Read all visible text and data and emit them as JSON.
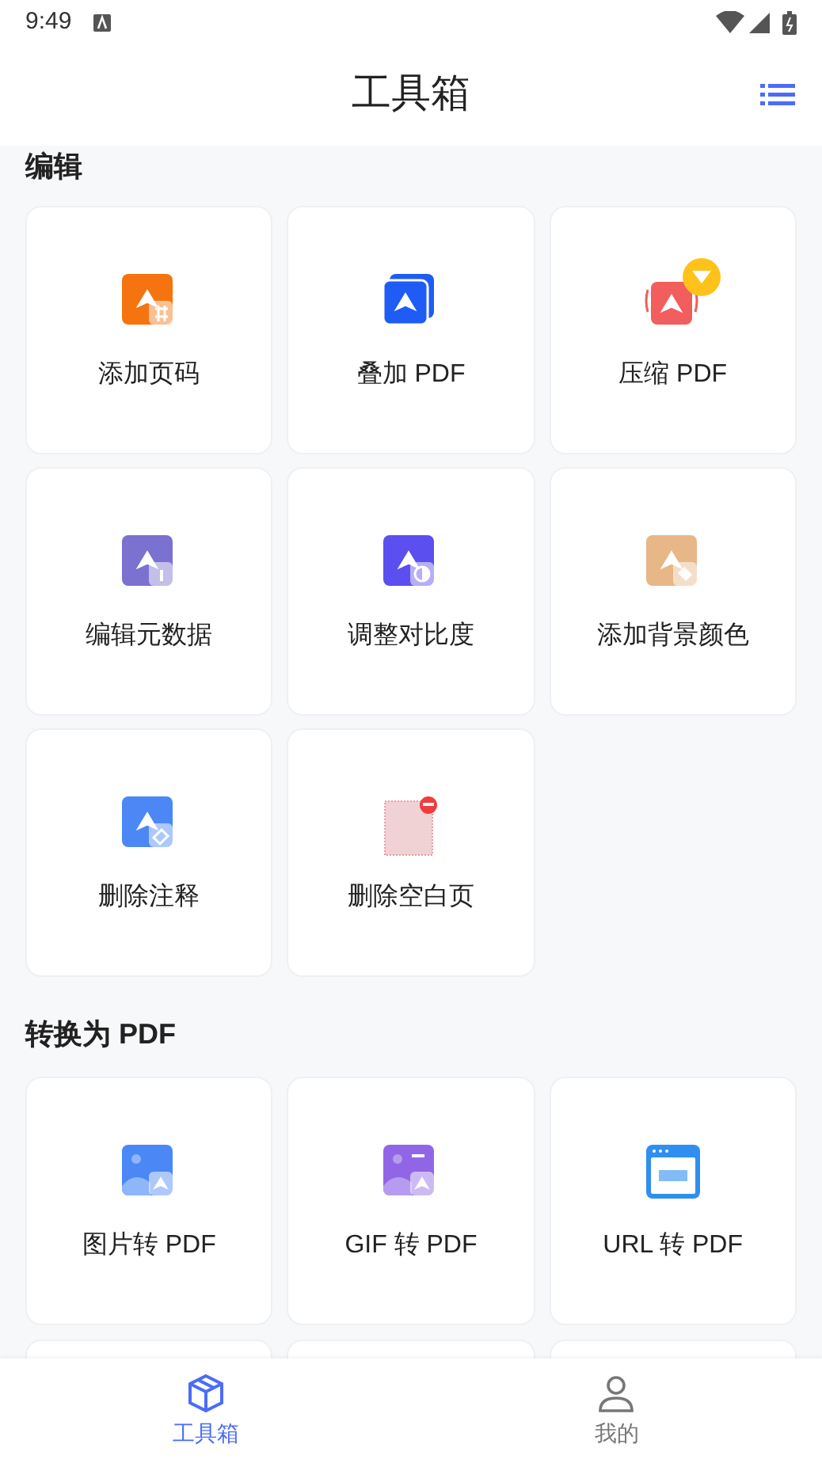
{
  "status_bar": {
    "time": "9:49"
  },
  "header": {
    "title": "工具箱"
  },
  "sections": [
    {
      "title": "编辑",
      "tools": [
        {
          "label": "添加页码",
          "kind": "page-number",
          "vip": false
        },
        {
          "label": "叠加 PDF",
          "kind": "overlay",
          "vip": false
        },
        {
          "label": "压缩 PDF",
          "kind": "compress",
          "vip": true
        },
        {
          "label": "编辑元数据",
          "kind": "metadata",
          "vip": false
        },
        {
          "label": "调整对比度",
          "kind": "contrast",
          "vip": false
        },
        {
          "label": "添加背景颜色",
          "kind": "background",
          "vip": false
        },
        {
          "label": "删除注释",
          "kind": "annotation",
          "vip": false
        },
        {
          "label": "删除空白页",
          "kind": "blank-page",
          "vip": false
        }
      ]
    },
    {
      "title": "转换为 PDF",
      "tools": [
        {
          "label": "图片转 PDF",
          "kind": "image",
          "vip": false
        },
        {
          "label": "GIF 转 PDF",
          "kind": "gif",
          "vip": false
        },
        {
          "label": "URL 转 PDF",
          "kind": "url",
          "vip": false
        }
      ]
    }
  ],
  "bottom_nav": [
    {
      "label": "工具箱",
      "kind": "toolbox",
      "selected": true
    },
    {
      "label": "我的",
      "kind": "profile",
      "selected": false
    }
  ]
}
